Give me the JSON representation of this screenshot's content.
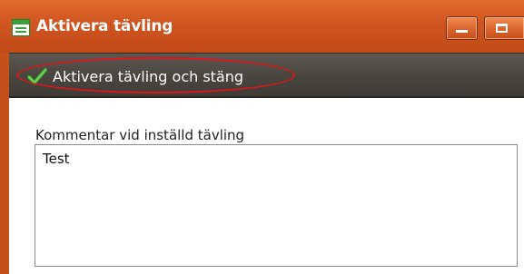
{
  "window": {
    "title": "Aktivera tävling",
    "app_icon": "form-document-icon",
    "minimize_icon": "minimize-icon",
    "maximize_icon": "maximize-icon",
    "title_bar_color": "#cf5520"
  },
  "toolbar": {
    "activate_close_label": "Aktivera tävling och stäng",
    "activate_close_icon": "green-checkmark-icon",
    "background_color": "#4a4640"
  },
  "annotation": {
    "highlight_color": "#e0141a",
    "shape": "ellipse-around-activate-button"
  },
  "form": {
    "comment_label": "Kommentar vid inställd tävling",
    "comment_value": "Test"
  }
}
